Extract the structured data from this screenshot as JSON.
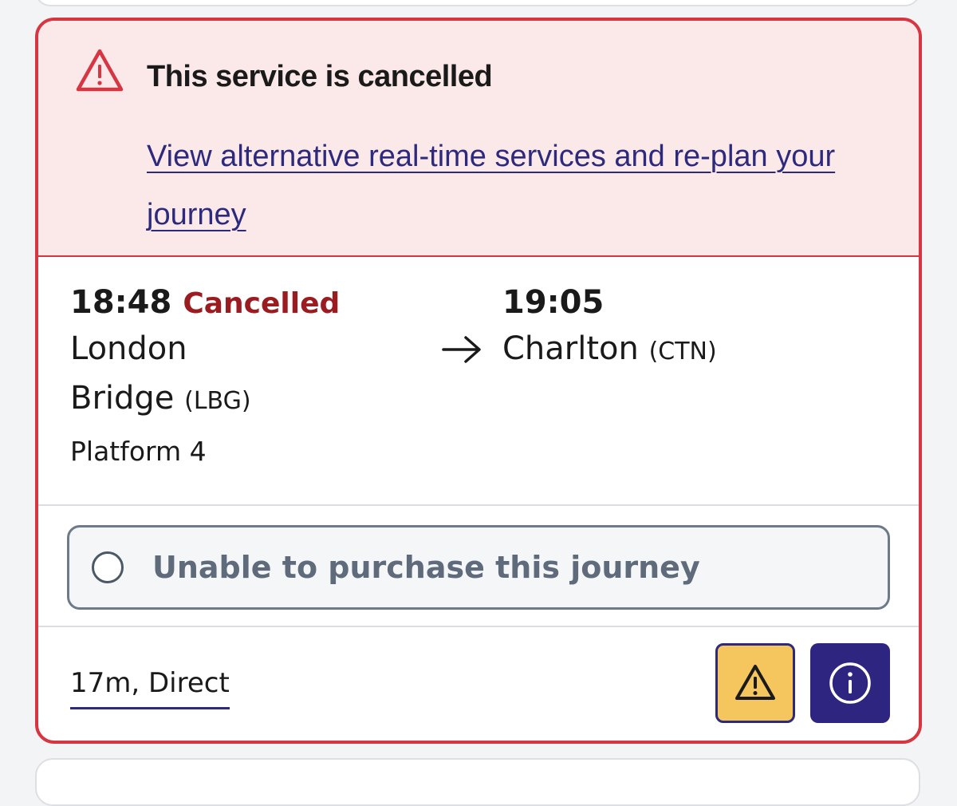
{
  "alert": {
    "title": "This service is cancelled",
    "link_text": "View alternative real-time services and re-plan your journey",
    "color": "#d63642",
    "background": "#fbe8e9"
  },
  "journey": {
    "departure": {
      "time": "18:48",
      "status": "Cancelled",
      "station_line1": "London",
      "station_line2": "Bridge",
      "code": "(LBG)",
      "platform": "Platform 4"
    },
    "arrival": {
      "time": "19:05",
      "station": "Charlton",
      "code": "(CTN)"
    },
    "arrow_icon": "arrow-right-icon"
  },
  "purchase": {
    "label": "Unable to purchase this journey"
  },
  "footer": {
    "summary": "17m, Direct",
    "warning_icon": "warning-icon",
    "info_icon": "info-icon"
  },
  "colors": {
    "brand": "#2d2a7d",
    "cancel_text": "#9b1c20",
    "warning_button": "#f5c65d",
    "info_button": "#2d2580"
  }
}
